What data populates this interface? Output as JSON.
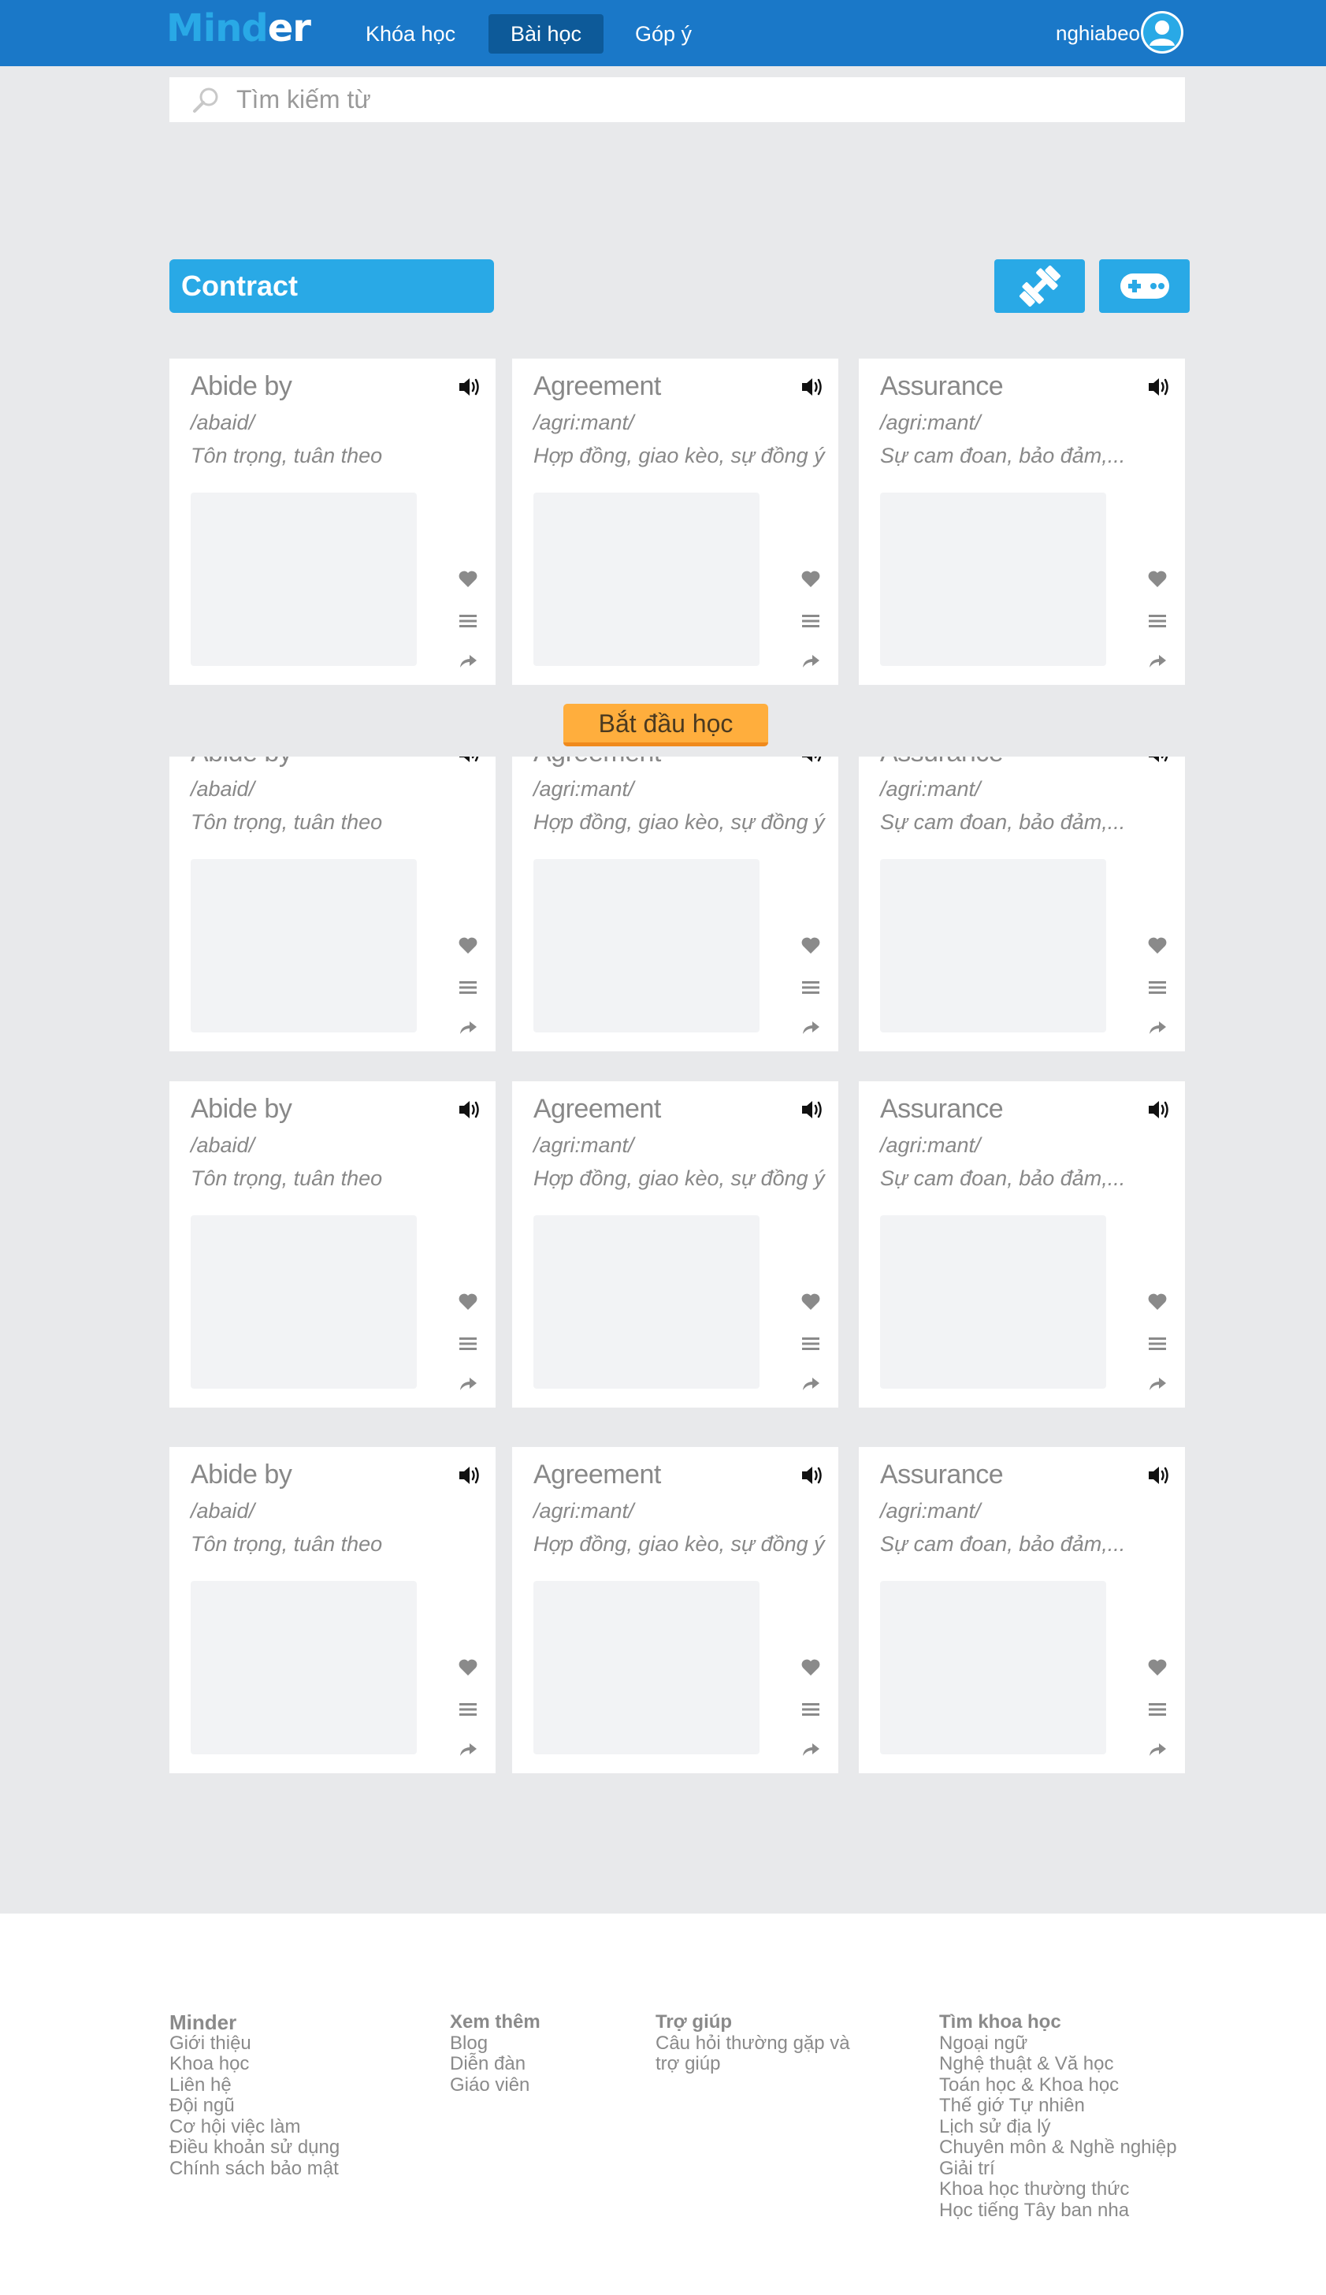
{
  "header": {
    "logo_part1": "Mind",
    "logo_part2": "er",
    "nav": [
      "Khóa học",
      "Bài học",
      "Góp ý"
    ],
    "active_nav": "Bài học",
    "username": "nghiabeo"
  },
  "search": {
    "placeholder": "Tìm kiếm từ"
  },
  "topic": {
    "title": "Contract"
  },
  "cards": [
    {
      "word": "Abide by",
      "phonetic": "/abaid/",
      "meaning": "Tôn trọng, tuân theo"
    },
    {
      "word": "Agreement",
      "phonetic": "/agri:mant/",
      "meaning": "Hợp đồng, giao kèo, sự đồng ý"
    },
    {
      "word": "Assurance",
      "phonetic": "/agri:mant/",
      "meaning": "Sự cam đoan, bảo đảm,..."
    }
  ],
  "start_button": "Bắt đầu học",
  "footer": {
    "col1": {
      "heading": "Minder",
      "links": [
        "Giới thiệu",
        "Khoa học",
        "Liên hệ",
        "Đội ngũ",
        "Cơ hội việc làm",
        "Điều khoản sử dụng",
        "Chính sách bảo mật"
      ]
    },
    "col2": {
      "heading": "Xem thêm",
      "links": [
        "Blog",
        "Diễn đàn",
        "Giáo viên"
      ]
    },
    "col3": {
      "heading": "Trợ giúp",
      "links": [
        "Câu hỏi thường gặp và",
        "trợ giúp"
      ]
    },
    "col4": {
      "heading": "Tìm khoa học",
      "links": [
        "Ngoại ngữ",
        "Nghệ thuật & Vă học",
        "Toán học & Khoa học",
        "Thế giớ Tự nhiên",
        "Lịch sử địa lý",
        "Chuyên môn & Nghề nghiệp",
        "Giải trí",
        "Khoa học thường thức",
        "Học tiếng Tây ban nha"
      ]
    }
  },
  "colors": {
    "brand": "#1a78c8",
    "accent": "#29a9e6",
    "start": "#ffae3d"
  }
}
